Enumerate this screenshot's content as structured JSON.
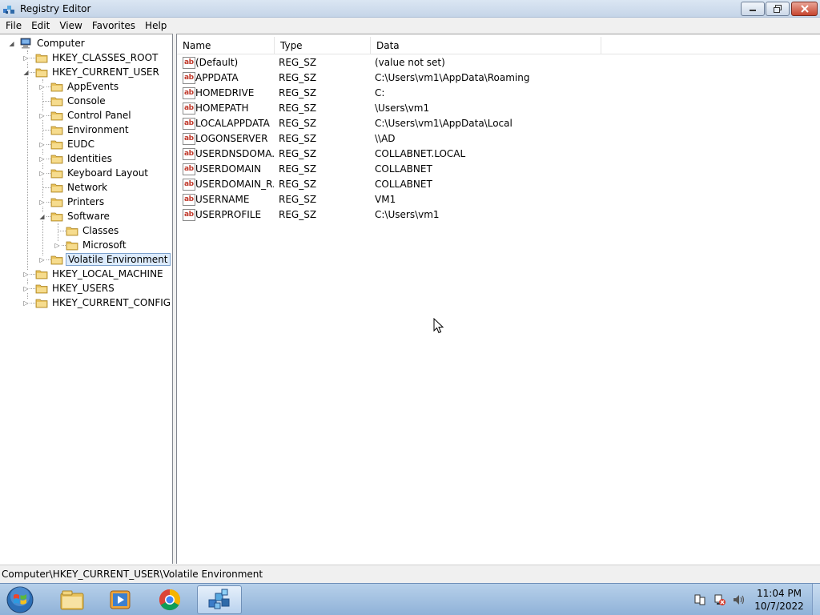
{
  "window": {
    "title": "Registry Editor"
  },
  "menu": [
    "File",
    "Edit",
    "View",
    "Favorites",
    "Help"
  ],
  "tree": {
    "root": "Computer",
    "nodes": [
      {
        "label": "HKEY_CLASSES_ROOT",
        "expander": "▷"
      },
      {
        "label": "HKEY_CURRENT_USER",
        "expander": "◢"
      },
      {
        "label": "AppEvents",
        "expander": "▷"
      },
      {
        "label": "Console",
        "expander": ""
      },
      {
        "label": "Control Panel",
        "expander": "▷"
      },
      {
        "label": "Environment",
        "expander": ""
      },
      {
        "label": "EUDC",
        "expander": "▷"
      },
      {
        "label": "Identities",
        "expander": "▷"
      },
      {
        "label": "Keyboard Layout",
        "expander": "▷"
      },
      {
        "label": "Network",
        "expander": ""
      },
      {
        "label": "Printers",
        "expander": "▷"
      },
      {
        "label": "Software",
        "expander": "◢"
      },
      {
        "label": "Classes",
        "expander": ""
      },
      {
        "label": "Microsoft",
        "expander": "▷"
      },
      {
        "label": "Volatile Environment",
        "expander": "▷"
      },
      {
        "label": "HKEY_LOCAL_MACHINE",
        "expander": "▷"
      },
      {
        "label": "HKEY_USERS",
        "expander": "▷"
      },
      {
        "label": "HKEY_CURRENT_CONFIG",
        "expander": "▷"
      }
    ]
  },
  "list": {
    "columns": [
      "Name",
      "Type",
      "Data"
    ],
    "icon_label": "ab",
    "rows": [
      {
        "name": "(Default)",
        "type": "REG_SZ",
        "data": "(value not set)"
      },
      {
        "name": "APPDATA",
        "type": "REG_SZ",
        "data": "C:\\Users\\vm1\\AppData\\Roaming"
      },
      {
        "name": "HOMEDRIVE",
        "type": "REG_SZ",
        "data": "C:"
      },
      {
        "name": "HOMEPATH",
        "type": "REG_SZ",
        "data": "\\Users\\vm1"
      },
      {
        "name": "LOCALAPPDATA",
        "type": "REG_SZ",
        "data": "C:\\Users\\vm1\\AppData\\Local"
      },
      {
        "name": "LOGONSERVER",
        "type": "REG_SZ",
        "data": "\\\\AD"
      },
      {
        "name": "USERDNSDOMA...",
        "type": "REG_SZ",
        "data": "COLLABNET.LOCAL"
      },
      {
        "name": "USERDOMAIN",
        "type": "REG_SZ",
        "data": "COLLABNET"
      },
      {
        "name": "USERDOMAIN_R...",
        "type": "REG_SZ",
        "data": "COLLABNET"
      },
      {
        "name": "USERNAME",
        "type": "REG_SZ",
        "data": "VM1"
      },
      {
        "name": "USERPROFILE",
        "type": "REG_SZ",
        "data": "C:\\Users\\vm1"
      }
    ]
  },
  "status": {
    "path": "Computer\\HKEY_CURRENT_USER\\Volatile Environment"
  },
  "taskbar": {
    "apps": [
      "file-explorer-icon",
      "media-player-icon",
      "chrome-icon",
      "registry-editor-icon"
    ],
    "time": "11:04 PM",
    "date": "10/7/2022"
  },
  "colors": {
    "selection": "#dcebfc",
    "folder": "#e8c15a",
    "close": "#c7452f"
  }
}
